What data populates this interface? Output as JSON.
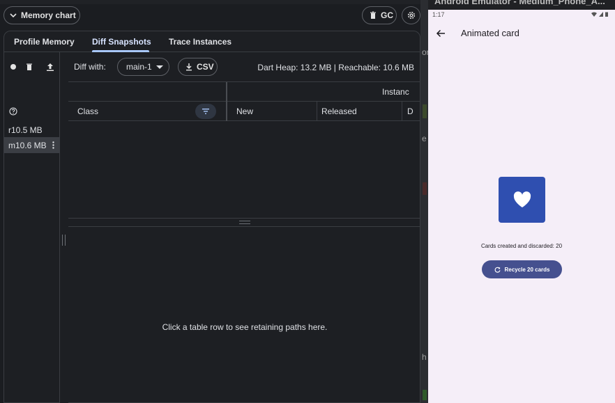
{
  "devtools": {
    "memory_chart_label": "Memory chart",
    "gc_label": "GC",
    "tabs": [
      {
        "label": "Profile Memory"
      },
      {
        "label": "Diff Snapshots"
      },
      {
        "label": "Trace Instances"
      }
    ],
    "snapshots": [
      {
        "label": "r10.5 MB"
      },
      {
        "label": "m10.6 MB"
      }
    ],
    "diff_with_label": "Diff with:",
    "snapshot_select_value": "main-1",
    "csv_label": "CSV",
    "heap_stats": "Dart Heap: 13.2 MB | Reachable: 10.6 MB",
    "table": {
      "group_header": "Instanc",
      "columns": [
        "Class",
        "New",
        "Released",
        "D"
      ]
    },
    "retaining_paths_message": "Click a table row to see retaining paths here."
  },
  "edge_fragments": [
    "or",
    "e",
    "h"
  ],
  "emulator": {
    "window_title": "Android Emulator - Medium_Phone_A...",
    "clock": "1:17",
    "app_title": "Animated card",
    "cards_info": "Cards created and discarded: 20",
    "recycle_button_label": "Recycle 20 cards",
    "accent": "#2f4fb0"
  }
}
